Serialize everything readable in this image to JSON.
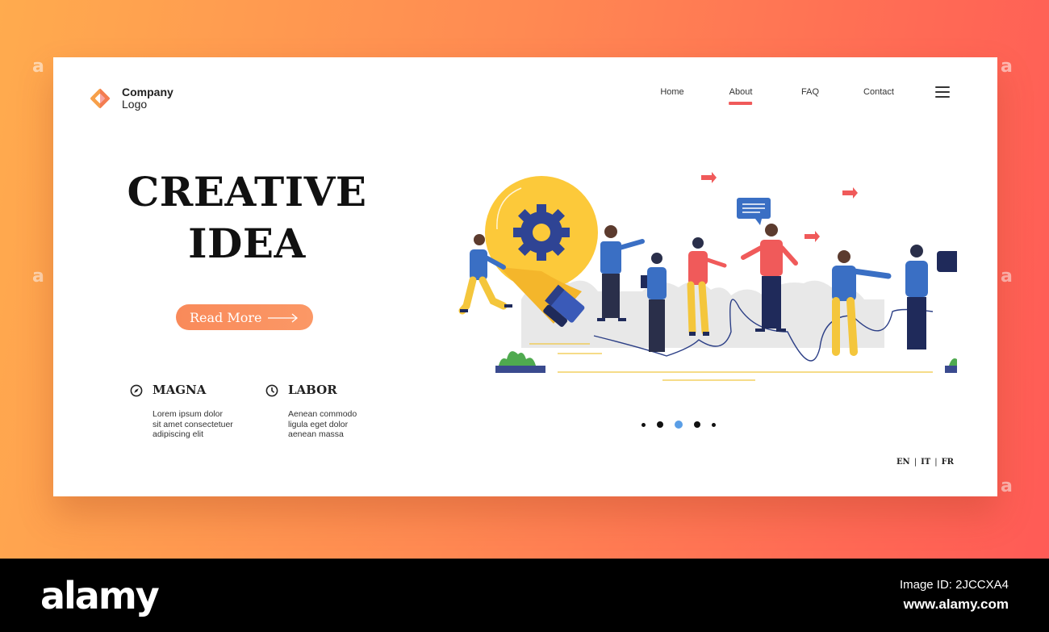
{
  "brand": {
    "name_line1": "Company",
    "name_line2": "Logo"
  },
  "nav": {
    "items": [
      {
        "label": "Home",
        "active": false
      },
      {
        "label": "About",
        "active": true
      },
      {
        "label": "FAQ",
        "active": false
      },
      {
        "label": "Contact",
        "active": false
      }
    ],
    "menu_icon": "hamburger-menu-icon"
  },
  "hero": {
    "title_line1": "CREATIVE",
    "title_line2": "IDEA",
    "cta_label": "Read More"
  },
  "features": [
    {
      "icon": "compass-icon",
      "title": "MAGNA",
      "lines": [
        "Lorem ipsum dolor",
        "sit amet consectetuer",
        "adipiscing elit"
      ]
    },
    {
      "icon": "clock-icon",
      "title": "LABOR",
      "lines": [
        "Aenean commodo",
        "ligula eget dolor",
        "aenean massa"
      ]
    }
  ],
  "slider": {
    "count": 5,
    "active_index": 2
  },
  "languages": [
    "EN",
    "IT",
    "FR"
  ],
  "colors": {
    "accent": "#f05a5a",
    "button": "#f98a5a",
    "bulb": "#fcc93a",
    "gear": "#2f4494",
    "active_dot": "#5a9ee6",
    "background_start": "#ffab4e",
    "background_end": "#ff5a56"
  },
  "watermark": {
    "brand": "alamy",
    "image_id": "Image ID: 2JCCXA4",
    "url": "www.alamy.com"
  }
}
